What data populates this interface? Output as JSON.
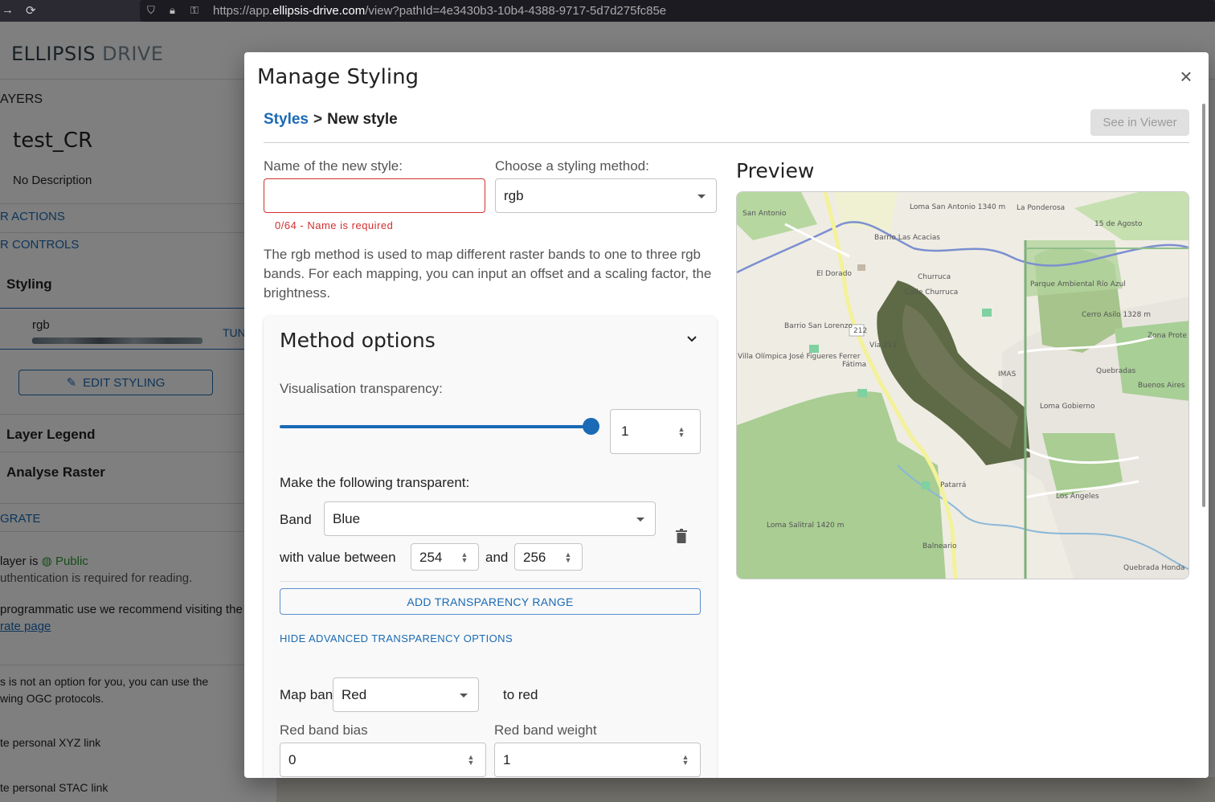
{
  "browser": {
    "url_prefix": "https://app.",
    "url_domain": "ellipsis-drive.com",
    "url_path": "/view?pathId=4e3430b3-10b4-4388-9717-5d7d275fc85e"
  },
  "app": {
    "logo_main": "ELLIPSIS",
    "logo_sub": "DRIVE",
    "sidebar": {
      "section": "AYERS",
      "layer_name": "test_CR",
      "layer_description": "No Description",
      "actions": "R ACTIONS",
      "controls": "R CONTROLS",
      "styling": "Styling",
      "style_name": "rgb",
      "style_action": "TUN",
      "edit_styling": "EDIT STYLING",
      "legend": "Layer Legend",
      "analyse": "Analyse Raster",
      "integrate": "GRATE",
      "layer_is": "layer is",
      "public": "Public",
      "auth_note": "uthentication is required for reading.",
      "programmatic": "programmatic use we recommend visiting the",
      "rate_page": "rate page",
      "ogc_1": "s is not an option for you, you can use the",
      "ogc_2": "wing OGC protocols.",
      "xyz_link": "te personal XYZ link",
      "stac_link": "te personal STAC link"
    }
  },
  "modal": {
    "title": "Manage Styling",
    "breadcrumb_root": "Styles",
    "breadcrumb_sep": ">",
    "breadcrumb_current": "New style",
    "see_in_viewer": "See in Viewer",
    "name_label": "Name of the new style:",
    "name_value": "",
    "name_helper": "0/64 - Name is required",
    "method_label": "Choose a styling method:",
    "method_value": "rgb",
    "description": "The rgb method is used to map different raster bands to one to three rgb bands. For each mapping, you can input an offset and a scaling factor, the brightness.",
    "method_options": {
      "title": "Method options",
      "transparency_label": "Visualisation transparency:",
      "transparency_value": "1",
      "transparency_fraction": 1,
      "make_transparent_label": "Make the following transparent:",
      "band_label": "Band",
      "band_value": "Blue",
      "with_value_between": "with value between",
      "range_min": "254",
      "and": "and",
      "range_max": "256",
      "add_range": "ADD TRANSPARENCY RANGE",
      "hide_advanced": "HIDE ADVANCED TRANSPARENCY OPTIONS",
      "map_band_label": "Map band",
      "map_band_value": "Red",
      "to_red": "to red",
      "red_bias_label": "Red band bias",
      "red_bias_value": "0",
      "red_weight_label": "Red band weight",
      "red_weight_value": "1"
    },
    "preview": {
      "title": "Preview",
      "map_labels": [
        "San Antonio",
        "Barrio Las Acacias",
        "El Dorado",
        "Calle Churruca",
        "Churruca",
        "Barrio San Lorenzo",
        "Fátima",
        "Villa Olímpica José Figueres Ferrer",
        "La Ponderosa",
        "15 de Agosto",
        "Parque Ambiental Río Azul",
        "Cerro Asilo 1328 m",
        "Quebradas",
        "Loma Gobierno",
        "Buenos Aires",
        "Patarrá",
        "Los Ángeles",
        "Loma Salitral 1420 m",
        "Balneario",
        "Quebrada Honda",
        "Zona Prote",
        "Loma San Antonio 1340 m",
        "212",
        "Vía 212",
        "IMAS"
      ]
    }
  }
}
